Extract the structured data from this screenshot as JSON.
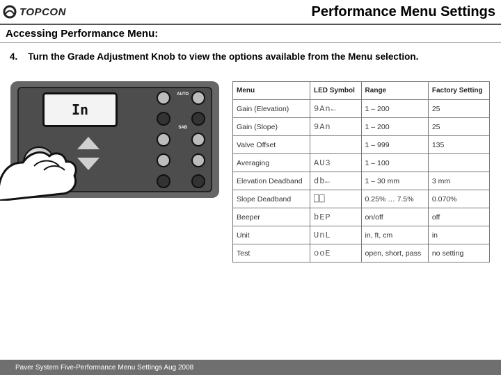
{
  "header": {
    "brand": "TOPCON",
    "title": "Performance Menu Settings"
  },
  "subhead": "Accessing Performance Menu:",
  "step": {
    "num": "4.",
    "text": "Turn the Grade Adjustment Knob to view the options available from the Menu selection."
  },
  "device": {
    "lcd_text": "In",
    "label_auto": "AUTO",
    "label_sab": "SAB"
  },
  "table": {
    "headers": [
      "Menu",
      "LED Symbol",
      "Range",
      "Factory Setting"
    ],
    "rows": [
      {
        "menu": "Gain (Elevation)",
        "sym": "9An←",
        "range": "1 – 200",
        "factory": "25"
      },
      {
        "menu": "Gain (Slope)",
        "sym": "9An",
        "range": "1 – 200",
        "factory": "25"
      },
      {
        "menu": "Valve Offset",
        "sym": "",
        "range": "1 – 999",
        "factory": "135"
      },
      {
        "menu": "Averaging",
        "sym": "AU3",
        "range": "1 – 100",
        "factory": ""
      },
      {
        "menu": "Elevation Deadband",
        "sym": "db←",
        "range": "1 – 30 mm",
        "factory": "3 mm"
      },
      {
        "menu": "Slope Deadband",
        "sym": "⎕⎕",
        "range": "0.25% … 7.5%",
        "factory": "0.070%"
      },
      {
        "menu": "Beeper",
        "sym": "bEP",
        "range": "on/off",
        "factory": "off"
      },
      {
        "menu": "Unit",
        "sym": "UnL",
        "range": "in, ft, cm",
        "factory": "in"
      },
      {
        "menu": "Test",
        "sym": "ooE",
        "range": "open, short, pass",
        "factory": "no setting"
      }
    ]
  },
  "footer": "Paver System Five-Performance Menu Settings  Aug 2008"
}
